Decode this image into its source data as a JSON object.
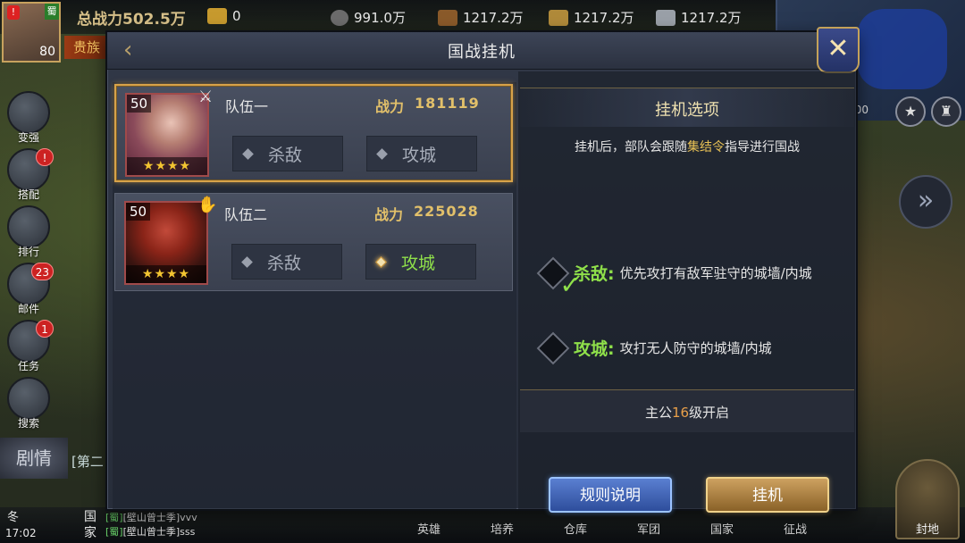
{
  "hud": {
    "total_power_label": "总战力",
    "total_power_value": "502.5万",
    "vip_label": "贵族",
    "player_level": "80",
    "player_alert": "!",
    "player_flag": "蜀",
    "resources": [
      {
        "icon": "food-icon",
        "value": "0"
      },
      {
        "icon": "coin-icon",
        "value": "991.0万"
      },
      {
        "icon": "wood-icon",
        "value": "1217.2万"
      },
      {
        "icon": "stone-icon",
        "value": "1217.2万"
      },
      {
        "icon": "iron-icon",
        "value": "1217.2万"
      }
    ],
    "minimap_coord": "00",
    "sidebar": [
      {
        "label": "变强",
        "badge": ""
      },
      {
        "label": "搭配",
        "badge": "!"
      },
      {
        "label": "排行",
        "badge": ""
      },
      {
        "label": "邮件",
        "badge": "23"
      },
      {
        "label": "任务",
        "badge": "1"
      },
      {
        "label": "搜索",
        "badge": ""
      }
    ],
    "story_label": "剧情",
    "story_peek": "[第二",
    "season": "冬",
    "clock": "17:02",
    "chat_channel": "国家",
    "chat_lines": [
      {
        "tag": "[蜀]",
        "text": "[壁山曾士季]vvv"
      },
      {
        "tag": "[蜀]",
        "text": "[壁山曾士季]sss"
      }
    ],
    "bottom_nav": [
      "英雄",
      "培养",
      "仓库",
      "军团",
      "国家",
      "征战"
    ],
    "fief_label": "封地"
  },
  "modal": {
    "title": "国战挂机",
    "teams": [
      {
        "name": "队伍一",
        "level": "50",
        "stars": "★★★★",
        "power_label": "战力",
        "power": "181119",
        "selected": true,
        "kill_label": "杀敌",
        "siege_label": "攻城",
        "active_mode": "none"
      },
      {
        "name": "队伍二",
        "level": "50",
        "stars": "★★★★",
        "power_label": "战力",
        "power": "225028",
        "selected": false,
        "kill_label": "杀敌",
        "siege_label": "攻城",
        "active_mode": "siege"
      }
    ],
    "options": {
      "title": "挂机选项",
      "desc_before": "挂机后，部队会跟随",
      "desc_highlight": "集结令",
      "desc_after": "指导进行国战",
      "items": [
        {
          "name": "杀敌:",
          "text": "优先攻打有敌军驻守的城墙/内城",
          "checked": true
        },
        {
          "name": "攻城:",
          "text": "攻打无人防守的城墙/内城",
          "checked": false
        }
      ],
      "unlock_before": "主公",
      "unlock_level": "16",
      "unlock_after": "级开启"
    },
    "rules_button": "规则说明",
    "afk_button": "挂机"
  }
}
